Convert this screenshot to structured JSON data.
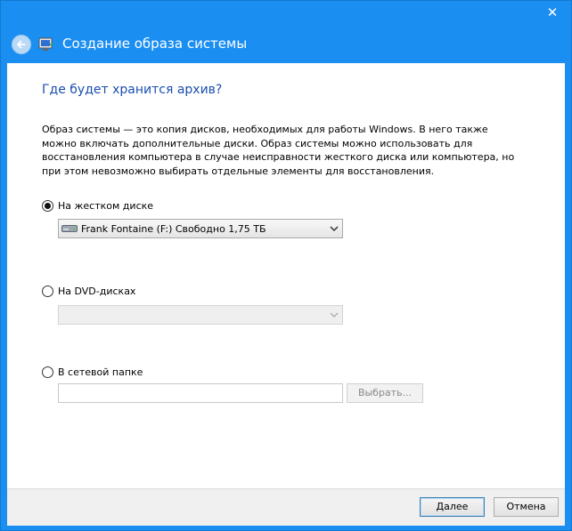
{
  "window": {
    "title": "Создание образа системы",
    "close_glyph": "✕"
  },
  "page": {
    "heading": "Где будет хранится архив?",
    "description": "Образ системы — это копия дисков, необходимых для работы Windows. В него также можно включать дополнительные диски. Образ системы можно использовать для восстановления компьютера в случае неисправности жесткого диска или компьютера, но при этом невозможно выбирать отдельные элементы для восстановления."
  },
  "options": {
    "hard_disk": {
      "label": "На жестком диске",
      "selected": true,
      "drive_value": "Frank Fontaine (F:)  Свободно 1,75 ТБ"
    },
    "dvd": {
      "label": "На DVD-дисках",
      "selected": false,
      "drive_value": ""
    },
    "network": {
      "label": "В сетевой папке",
      "selected": false,
      "path_value": "",
      "browse_label": "Выбрать..."
    }
  },
  "footer": {
    "next_label": "Далее",
    "cancel_label": "Отмена"
  },
  "icons": {
    "back": "back-arrow-icon",
    "app": "system-image-icon",
    "drive": "hard-drive-icon",
    "chevron": "chevron-down-icon"
  },
  "colors": {
    "frame": "#1b8ef2",
    "heading": "#1b4eb1"
  }
}
